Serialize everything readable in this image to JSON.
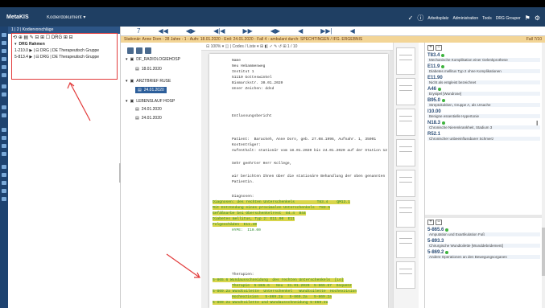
{
  "window": {
    "app_name": "MetaKIS",
    "module_dropdown": "Kodierdokument ▾",
    "status_right": [
      "Arbeitsplatz",
      "Administration",
      "Tools",
      "DRG Grouper"
    ]
  },
  "left_panel": {
    "header": "1 | 2 | Kodiervorschläge",
    "tools": "⟲ ⊕ ▤ ✎ ⊟ ⊞ ☐ DRG  ⊞  ⊟",
    "rows": [
      {
        "label": "DRG Rahmen",
        "bold": true
      },
      {
        "label": "1-210.0 ▶  |  ⊟ DRG | DE Therapeutisch Gruppe"
      },
      {
        "label": "5-813.4 ▶  |  ⊟ DRG | DE Therapeutisch Gruppe"
      }
    ]
  },
  "doc_toolbar": {
    "icons": [
      "7",
      "◀◀",
      "◀▶",
      "◀|◀",
      "▶▶",
      "◀▶",
      "◀",
      "▶▶|",
      "◀"
    ]
  },
  "doc_info": {
    "text": "Stationär: Anne Dorn - 28 Jahre - 1 - Aufn: 18.01.2020 - Entl: 24.01.2020 - Fall 4 - ambulant durch: SPECHTINGEN / IFG. ERGEBNIS",
    "right": "Fall 7/10"
  },
  "tree": {
    "nodes": [
      {
        "label": "DF_RADIOLOGIEHOSP"
      },
      {
        "label": "18.01.2020"
      },
      {
        "label": "ARZTBRIEF RUSE"
      },
      {
        "label": "24.01.2020",
        "selected": true
      },
      {
        "label": "LEBENSLAUF HOSP"
      },
      {
        "label": "24.01.2020"
      },
      {
        "label": "24.01.2020"
      }
    ]
  },
  "document": {
    "toolbar": "⊟ 100%  ▾  ◫  |  Codes / Liste  ▾     ⊞  ◧  ✓  ✎  ↺  ⊞      1 / 10",
    "lines": [
      "Name",
      "Neu Hebammenweg",
      "Institut 1",
      "51110 Gotteswinkel",
      "Bismarckstr. 30.01.2020",
      "Unser Zeichen: ddsd",
      "",
      "",
      "Entlassungsbericht",
      "",
      "Patient:  Barackeh, Anne Dorn, geb. 27.08.1996, Aufnahr. 1, 35001",
      "Kostenträger:",
      "Aufenthalt: stationär vom 18.01.2020 bis 24.01.2020 auf der Station 12",
      "",
      "Sehr geehrter Herr Kollege,",
      "",
      "wir berichten Ihnen über die stationäre Behandlung der oben genannten",
      "Patientin.",
      "",
      "Diagnosen:",
      "Diagnosen: des rechten Unterschenkels          T83.4    QM13.1",
      "Mit Entzündung eines proximalen Unterschenkels  T83.5",
      "Gefäßnarbe bei Oberschenkelrest  84.4  B44",
      "Diabetes mellitus, Typ 2: E11.90  E11",
      "Folgeschäden  E11.40",
      "HYPE:  I10.00",
      "",
      "",
      "",
      "Therapien:",
      "5-865.6 Wundausschneidung  des rechten Unterschenkels  [Lo]",
      "Therapie  5-865.6   Neu  31.01.2020  5-865.67  Sequenz",
      "5-869.2a Wundtoilette  Unterschenkel   Wundtoilette  Hochexzision",
      "Hochexzision   5-869.2a   5-869.2a   5-869.2a",
      "5-869.2a Wundtoilette und Wundausschneidung 5-869.2a"
    ]
  },
  "right_panel": {
    "codes_top": [
      {
        "code": "T83.4",
        "desc": "Mechanische Komplikation einer Gelenkprothese"
      },
      {
        "code": "E11.9",
        "desc": "Diabetes mellitus Typ 2 ohne Komplikationen"
      },
      {
        "code": "E11.90",
        "desc": "Nicht als entgleist bezeichnet"
      },
      {
        "code": "A46",
        "desc": "Erysipel [Wundrose]"
      },
      {
        "code": "B95.0",
        "desc": "Streptokokken, Gruppe A, als Ursache"
      },
      {
        "code": "I10.00",
        "desc": "Benigne essentielle Hypertonie"
      },
      {
        "code": "N18.3",
        "desc": "Chronische Nierenkrankheit, Stadium 3"
      },
      {
        "code": "R52.1",
        "desc": "Chronischer unbeeinflussbarer Schmerz"
      }
    ],
    "codes_bottom": [
      {
        "code": "5-865.6",
        "desc": "Amputation und Exartikulation Fuß"
      },
      {
        "code": "5-893.3",
        "desc": "Chirurgische Wundtoilette [Wunddebridement]"
      },
      {
        "code": "5-869.2",
        "desc": "Andere Operationen an den Bewegungsorganen"
      }
    ]
  }
}
